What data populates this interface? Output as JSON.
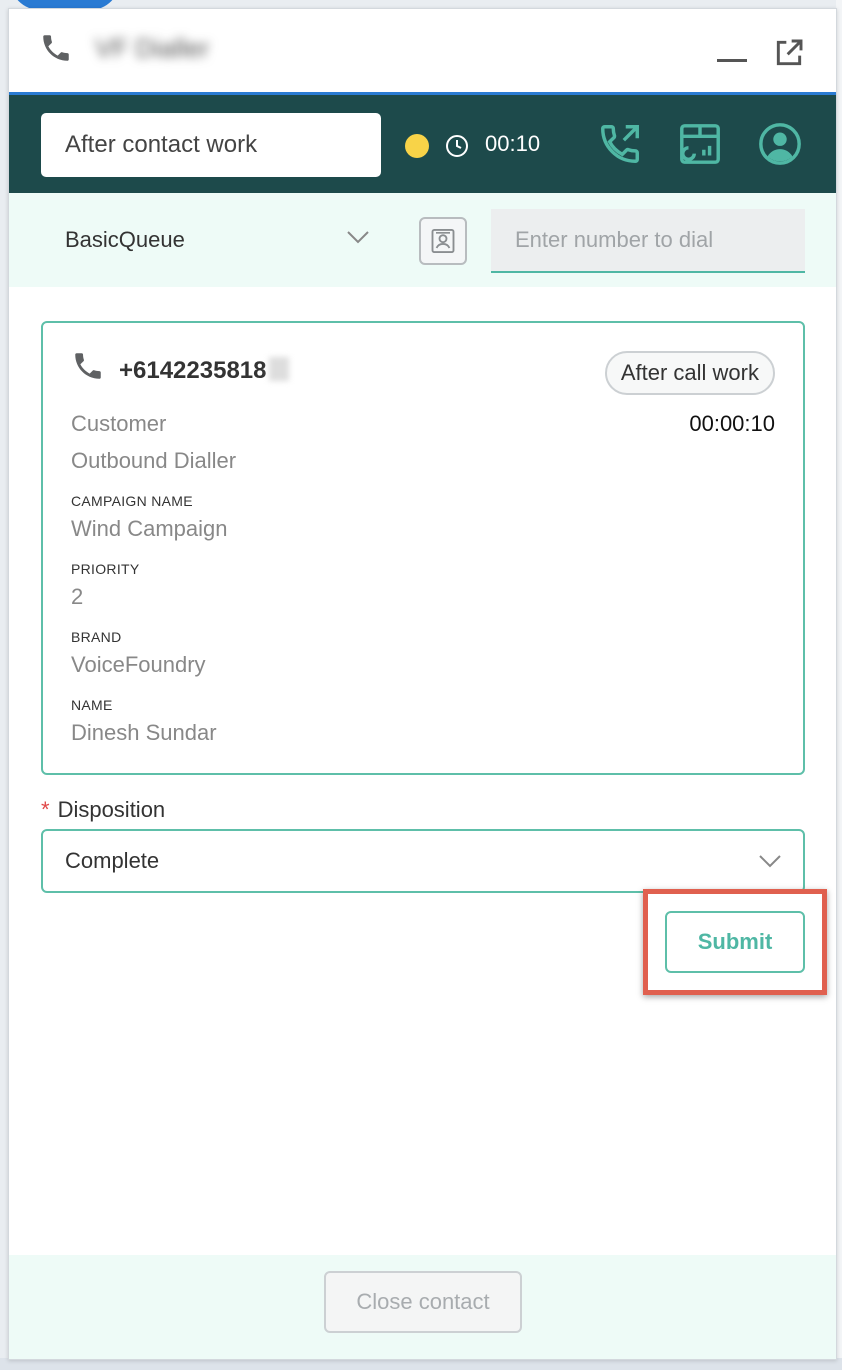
{
  "titlebar": {
    "title": "VF Dialler",
    "phone_icon": "phone-icon",
    "minimize_icon": "minimize-icon",
    "popout_icon": "popout-icon"
  },
  "header": {
    "status": "After contact work",
    "status_dot_color": "#f8d348",
    "timer": "00:10",
    "icons": [
      "outbound-call-icon",
      "dashboard-icon",
      "profile-icon"
    ]
  },
  "queue": {
    "selected": "BasicQueue",
    "dial_placeholder": "Enter number to dial"
  },
  "contact": {
    "number": "+6142235818",
    "state_badge": "After call work",
    "elapsed": "00:00:10",
    "role": "Customer",
    "source": "Outbound Dialler",
    "attributes": [
      {
        "label": "CAMPAIGN NAME",
        "value": "Wind Campaign"
      },
      {
        "label": "PRIORITY",
        "value": "2"
      },
      {
        "label": "BRAND",
        "value": "VoiceFoundry"
      },
      {
        "label": "NAME",
        "value": "Dinesh Sundar"
      }
    ]
  },
  "disposition": {
    "required_mark": "*",
    "label": "Disposition",
    "selected": "Complete"
  },
  "actions": {
    "submit_label": "Submit",
    "close_label": "Close contact"
  },
  "colors": {
    "header_bg": "#1d4a4b",
    "accent": "#5ebfa9",
    "highlight": "#e0604f"
  }
}
